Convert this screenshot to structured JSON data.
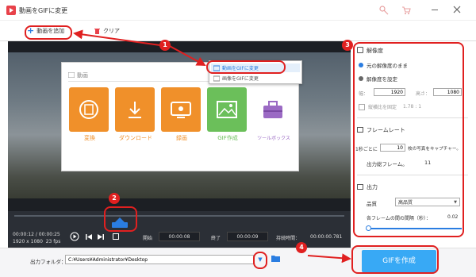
{
  "app": {
    "title": "動画をGIFに変更"
  },
  "toolbar": {
    "add_video": "動画を追加",
    "clear": "クリア"
  },
  "menu": {
    "title": "動画"
  },
  "tools": [
    {
      "label": "変換",
      "color": "#f0902a",
      "icon": "film-icon"
    },
    {
      "label": "ダウンロード",
      "color": "#f0902a",
      "icon": "download-icon"
    },
    {
      "label": "録画",
      "color": "#f0902a",
      "icon": "record-icon"
    },
    {
      "label": "GIF作成",
      "color": "#6bbf5a",
      "icon": "image-icon"
    },
    {
      "label": "ツールボックス",
      "color": "#9b6ac4",
      "icon": "toolbox-icon"
    }
  ],
  "dropdown": {
    "item1": "動画をGIFに変更",
    "item2": "画像をGIFに変更"
  },
  "player": {
    "current_time": "00:00:12",
    "total_time": "00:00:25",
    "resolution": "1920 x 1080",
    "fps": "23 fps",
    "start_label": "開始",
    "start_value": "00:00:08",
    "end_label": "終了",
    "end_value": "00:00:09",
    "duration_label": "持続時間：",
    "duration_value": "00:00:00.781"
  },
  "panel": {
    "resolution_title": "解像度",
    "keep_original": "元の解像度のまま",
    "set_resolution": "解像度を設定",
    "width_label": "幅：",
    "width_value": "1920",
    "height_label": "高さ：",
    "height_value": "1080",
    "fix_ratio": "縦横比を固定",
    "ratio": "1.78 : 1",
    "framerate_title": "フレームレート",
    "per_second": "1秒ごとに",
    "fps_value": "10",
    "capture_text": "枚の写真をキャプチャー。",
    "total_frames_label": "出力総フレーム。",
    "total_frames_value": "11",
    "output_title": "出力",
    "quality_label": "品質",
    "quality_value": "高品質",
    "interval_label": "各フレームの間の間隔（秒）：",
    "interval_value": "0.02"
  },
  "bottom": {
    "folder_label": "出力フォルダ：",
    "folder_path": "C:¥Users¥Administrator¥Desktop",
    "create_button": "GIFを作成"
  },
  "callouts": [
    "1",
    "2",
    "3",
    "4"
  ],
  "colors": {
    "accent": "#2a7de1",
    "callout": "#e02020",
    "create_button": "#38a9f5"
  }
}
